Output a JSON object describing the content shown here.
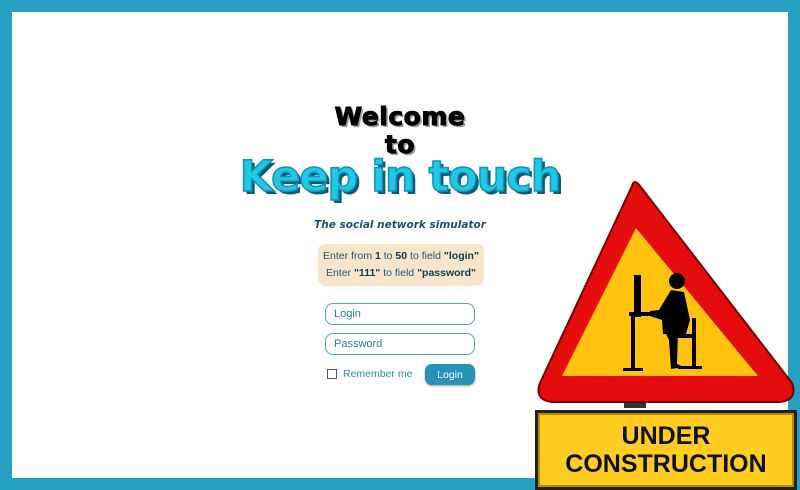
{
  "welcome": {
    "line1": "Welcome",
    "line2": "to"
  },
  "app": {
    "name": "Keep in touch",
    "tagline": "The social network simulator"
  },
  "hint": {
    "line1": {
      "pre": "Enter from ",
      "a": "1",
      "mid": " to ",
      "b": "50",
      "mid2": " to field ",
      "field": "\"login\""
    },
    "line2": {
      "pre": "Enter ",
      "value": "\"111\"",
      "mid": " to field ",
      "field": "\"password\""
    }
  },
  "form": {
    "login_placeholder": "Login",
    "password_placeholder": "Password",
    "remember_label": "Remember me",
    "submit_label": "Login"
  },
  "sign": {
    "line1": "UNDER",
    "line2": "CONSTRUCTION"
  },
  "colors": {
    "frame": "#26a1c4",
    "brand": "#21c7e4",
    "button": "#2692b8",
    "hint_bg": "#f6e4cb"
  }
}
